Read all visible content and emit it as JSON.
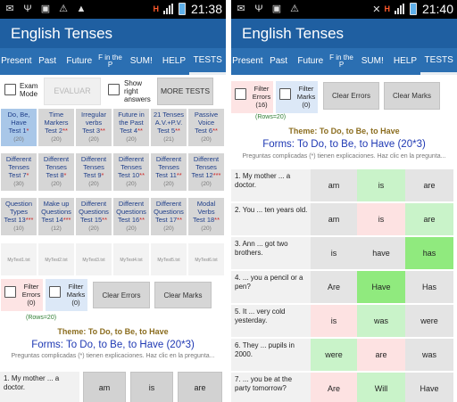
{
  "left": {
    "status": {
      "time": "21:38"
    },
    "app_title": "English Tenses",
    "tabs": [
      {
        "label": "Present"
      },
      {
        "label": "Past"
      },
      {
        "label": "Future"
      },
      {
        "label": "F in the P"
      },
      {
        "label": "SUM!"
      },
      {
        "label": "HELP"
      },
      {
        "label": "TESTS"
      }
    ],
    "exam_mode_label": "Exam Mode",
    "evaluar_label": "EVALUAR",
    "show_right_label": "Show right answers",
    "more_tests_label": "MORE TESTS",
    "tests": [
      {
        "title": "Do, Be, Have",
        "test": "Test 1",
        "stars": "*",
        "count": "(20)"
      },
      {
        "title": "Time Markers",
        "test": "Test 2",
        "stars": "**",
        "count": "(20)"
      },
      {
        "title": "Irregular verbs",
        "test": "Test 3",
        "stars": "**",
        "count": "(20)"
      },
      {
        "title": "Future in the Past",
        "test": "Test 4",
        "stars": "**",
        "count": "(20)"
      },
      {
        "title": "21 Tenses A.V.+P.V.",
        "test": "Test 5",
        "stars": "**",
        "count": "(21)"
      },
      {
        "title": "Passive Voice",
        "test": "Test 6",
        "stars": "**",
        "count": "(20)"
      },
      {
        "title": "Different Tenses",
        "test": "Test 7",
        "stars": "*",
        "count": "(30)"
      },
      {
        "title": "Different Tenses",
        "test": "Test 8",
        "stars": "*",
        "count": "(20)"
      },
      {
        "title": "Different Tenses",
        "test": "Test 9",
        "stars": "*",
        "count": "(20)"
      },
      {
        "title": "Different Tenses",
        "test": "Test 10",
        "stars": "**",
        "count": "(20)"
      },
      {
        "title": "Different Tenses",
        "test": "Test 11",
        "stars": "**",
        "count": "(20)"
      },
      {
        "title": "Different Tenses",
        "test": "Test 12",
        "stars": "***",
        "count": "(20)"
      },
      {
        "title": "Question Types",
        "test": "Test 13",
        "stars": "***",
        "count": "(10)"
      },
      {
        "title": "Make up Questions",
        "test": "Test 14",
        "stars": "***",
        "count": "(12)"
      },
      {
        "title": "Different Questions",
        "test": "Test 15",
        "stars": "**",
        "count": "(20)"
      },
      {
        "title": "Different Questions",
        "test": "Test 16",
        "stars": "**",
        "count": "(20)"
      },
      {
        "title": "Different Questions",
        "test": "Test 17",
        "stars": "**",
        "count": "(20)"
      },
      {
        "title": "Modal Verbs",
        "test": "Test 18",
        "stars": "**",
        "count": "(20)"
      }
    ],
    "mytests": [
      "MyTest1.txt",
      "MyTest2.txt",
      "MyTest3.txt",
      "MyTest4.txt",
      "MyTest5.txt",
      "MyTest6.txt"
    ],
    "filter_errors": {
      "label": "Filter Errors",
      "count": "(0)"
    },
    "filter_marks": {
      "label": "Filter Marks",
      "count": "(0)"
    },
    "clear_errors": "Clear Errors",
    "clear_marks": "Clear Marks",
    "rows": "(Rows=20)",
    "theme": "Theme: To Do, to Be, to Have",
    "forms": "Forms: To Do, to Be, to Have (20*3)",
    "hint": "Preguntas complicadas (*) tienen explicaciones. Haz clic en la pregunta...",
    "question": {
      "text": "1. My mother ... a doctor.",
      "options": [
        "am",
        "is",
        "are"
      ]
    }
  },
  "right": {
    "status": {
      "time": "21:40"
    },
    "app_title": "English Tenses",
    "tabs": [
      {
        "label": "Present"
      },
      {
        "label": "Past"
      },
      {
        "label": "Future"
      },
      {
        "label": "F in the P"
      },
      {
        "label": "SUM!"
      },
      {
        "label": "HELP"
      },
      {
        "label": "TESTS"
      }
    ],
    "filter_errors": {
      "label": "Filter Errors",
      "count": "(16)"
    },
    "filter_marks": {
      "label": "Filter Marks",
      "count": "(0)"
    },
    "clear_errors": "Clear Errors",
    "clear_marks": "Clear Marks",
    "rows": "(Rows=20)",
    "theme": "Theme: To Do, to Be, to Have",
    "forms": "Forms: To Do, to Be, to Have (20*3)",
    "hint": "Preguntas complicadas (*) tienen explicaciones. Haz clic en la pregunta...",
    "questions": [
      {
        "text": "1. My mother ... a doctor.",
        "options": [
          "am",
          "is",
          "are"
        ],
        "styles": [
          "grey",
          "green",
          "grey"
        ]
      },
      {
        "text": "2. You ... ten years old.",
        "options": [
          "am",
          "is",
          "are"
        ],
        "styles": [
          "grey",
          "pink",
          "green"
        ]
      },
      {
        "text": "3. Ann ... got two brothers.",
        "options": [
          "is",
          "have",
          "has"
        ],
        "styles": [
          "grey",
          "grey",
          "bright"
        ]
      },
      {
        "text": "4. ... you a pencil or a pen?",
        "options": [
          "Are",
          "Have",
          "Has"
        ],
        "styles": [
          "grey",
          "bright",
          "grey"
        ]
      },
      {
        "text": "5. It ... very cold yesterday.",
        "options": [
          "is",
          "was",
          "were"
        ],
        "styles": [
          "pink",
          "green",
          "grey"
        ]
      },
      {
        "text": "6. They ... pupils in 2000.",
        "options": [
          "were",
          "are",
          "was"
        ],
        "styles": [
          "green",
          "pink",
          "grey"
        ]
      },
      {
        "text": "7. ... you be at the party tomorrow?",
        "options": [
          "Are",
          "Will",
          "Have"
        ],
        "styles": [
          "pink",
          "green",
          "grey"
        ]
      }
    ]
  },
  "colors": {
    "actionbar": "#1f5fa1",
    "tabbar": "#2b6fb2",
    "theme_text": "#8b6d1f",
    "forms_text": "#1e38b3",
    "correct": "#c9f3c9",
    "chosen_correct": "#90ea7e",
    "wrong": "#fde2e2"
  }
}
